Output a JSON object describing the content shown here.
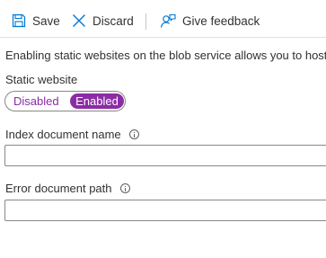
{
  "toolbar": {
    "save_label": "Save",
    "discard_label": "Discard",
    "feedback_label": "Give feedback"
  },
  "description": "Enabling static websites on the blob service allows you to host",
  "static_website": {
    "label": "Static website",
    "options": [
      "Disabled",
      "Enabled"
    ],
    "selected": "Enabled"
  },
  "index_document": {
    "label": "Index document name",
    "value": ""
  },
  "error_document": {
    "label": "Error document path",
    "value": ""
  },
  "colors": {
    "accent": "#8a2da5",
    "icon_blue": "#0078d4",
    "text": "#323130"
  }
}
